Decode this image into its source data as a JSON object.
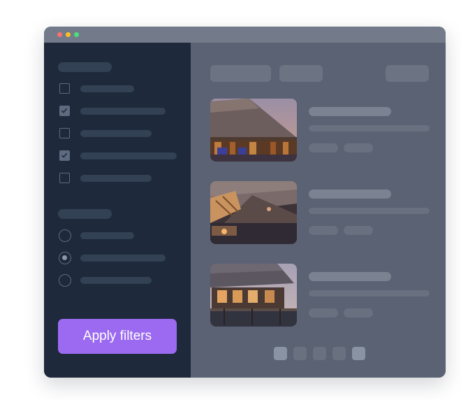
{
  "window": {
    "controls": [
      "close",
      "minimize",
      "maximize"
    ]
  },
  "colors": {
    "close": "#f87171",
    "minimize": "#fbbf24",
    "maximize": "#4ade80",
    "sidebar": "#1e293b",
    "main": "#5b6273",
    "accent": "#9b6af0"
  },
  "filters": {
    "checkboxes": [
      {
        "checked": false
      },
      {
        "checked": true
      },
      {
        "checked": false
      },
      {
        "checked": true
      },
      {
        "checked": false
      }
    ],
    "radios": [
      {
        "selected": false
      },
      {
        "selected": true
      },
      {
        "selected": false
      }
    ],
    "apply_label": "Apply filters"
  },
  "results": {
    "cards": [
      {
        "image": "thatched-resort-photo"
      },
      {
        "image": "thatched-roof-interior-photo"
      },
      {
        "image": "overwater-bungalow-photo"
      }
    ],
    "pagination": {
      "pages": 5,
      "active": [
        0,
        4
      ]
    }
  },
  "icons": [
    "check-icon",
    "radio-dot-icon"
  ]
}
